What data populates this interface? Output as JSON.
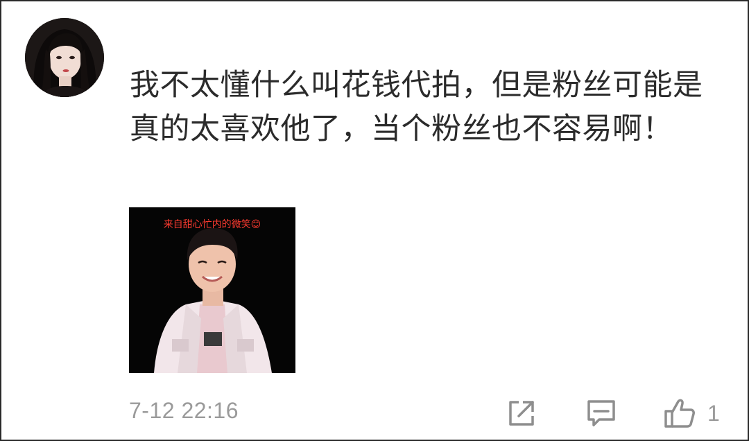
{
  "comment": {
    "text": "我不太懂什么叫花钱代拍，但是粉丝可能是真的太喜欢他了，当个粉丝也不容易啊！",
    "sticker_caption": "来自甜心忙内的微笑😊",
    "timestamp": "7-12 22:16"
  },
  "actions": {
    "share_icon": "share-icon",
    "reply_icon": "comment-icon",
    "like_icon": "thumbs-up-icon",
    "like_count": "1"
  },
  "colors": {
    "text": "#2b2b2b",
    "meta": "#9a9a9a",
    "caption": "#ff3b30",
    "sticker_bg": "#050505"
  }
}
